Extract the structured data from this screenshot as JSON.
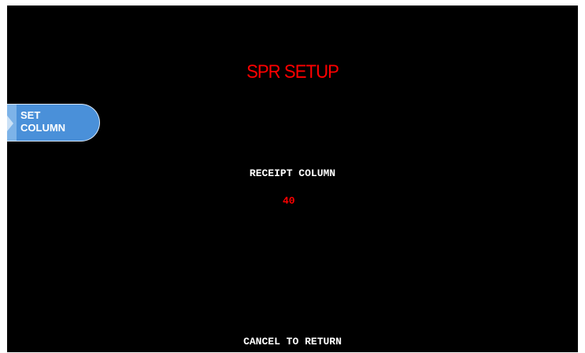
{
  "screen": {
    "title": "SPR SETUP",
    "title_color": "#ff0000",
    "background_color": "#000000"
  },
  "left_fdk": {
    "label": "SET\nCOLUMN",
    "color": "#4a90d9"
  },
  "receipt": {
    "label": "RECEIPT COLUMN",
    "value": "40",
    "value_color": "#ff0000"
  },
  "footer": {
    "text": "CANCEL TO RETURN"
  }
}
